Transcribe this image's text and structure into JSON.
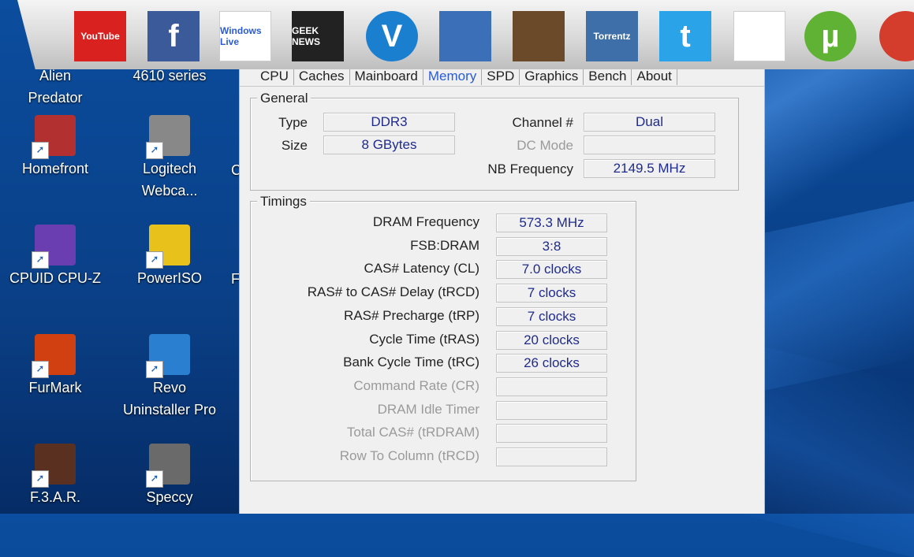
{
  "launcher": {
    "icons": [
      {
        "name": "youtube",
        "text": "YouTube",
        "color": "#d9211f"
      },
      {
        "name": "facebook",
        "text": "f",
        "color": "#3b5a9a"
      },
      {
        "name": "windows-live",
        "text": "Windows Live",
        "color": "#ffffff"
      },
      {
        "name": "news",
        "text": "GEEK NEWS",
        "color": "#222222"
      },
      {
        "name": "v-app",
        "text": "V",
        "color": "#1b7fd0"
      },
      {
        "name": "reddit-like",
        "text": "",
        "color": "#3b6fb8"
      },
      {
        "name": "chess",
        "text": "",
        "color": "#6b4a2a"
      },
      {
        "name": "torrentz",
        "text": "Torrentz",
        "color": "#3f6fa8"
      },
      {
        "name": "twitter",
        "text": "t",
        "color": "#2aa3e8"
      },
      {
        "name": "scrooge",
        "text": "",
        "color": "#ffffff"
      },
      {
        "name": "utorrent",
        "text": "µ",
        "color": "#5fb233"
      },
      {
        "name": "ccleaner",
        "text": "",
        "color": "#d43c2c"
      }
    ]
  },
  "desktop": {
    "icons": [
      {
        "label": "Alien\nPredator",
        "color": "#7a1a1a"
      },
      {
        "label": "4610 series",
        "color": "#c0c0c0"
      },
      {
        "label": "Homefront",
        "color": "#b23030"
      },
      {
        "label": "Logitech\nWebca...",
        "color": "#888888"
      },
      {
        "label": "CPUID CPU-Z",
        "color": "#6a3db0"
      },
      {
        "label": "PowerISO",
        "color": "#e8c21a"
      },
      {
        "label": "FurMark",
        "color": "#d04010"
      },
      {
        "label": "Revo\nUninstaller Pro",
        "color": "#2a7fd0"
      },
      {
        "label": "F.3.A.R.",
        "color": "#5a3020"
      },
      {
        "label": "Speccy",
        "color": "#6a6a6a"
      }
    ],
    "partials": [
      "C",
      "F"
    ]
  },
  "cpuz": {
    "tabs": [
      "CPU",
      "Caches",
      "Mainboard",
      "Memory",
      "SPD",
      "Graphics",
      "Bench",
      "About"
    ],
    "active_tab": "Memory",
    "general": {
      "legend": "General",
      "type_label": "Type",
      "type_value": "DDR3",
      "size_label": "Size",
      "size_value": "8 GBytes",
      "channel_label": "Channel #",
      "channel_value": "Dual",
      "dcmode_label": "DC Mode",
      "dcmode_value": "",
      "nbfreq_label": "NB Frequency",
      "nbfreq_value": "2149.5 MHz"
    },
    "timings": {
      "legend": "Timings",
      "rows": [
        {
          "label": "DRAM Frequency",
          "value": "573.3 MHz",
          "dim": false
        },
        {
          "label": "FSB:DRAM",
          "value": "3:8",
          "dim": false
        },
        {
          "label": "CAS# Latency (CL)",
          "value": "7.0 clocks",
          "dim": false
        },
        {
          "label": "RAS# to CAS# Delay (tRCD)",
          "value": "7 clocks",
          "dim": false
        },
        {
          "label": "RAS# Precharge (tRP)",
          "value": "7 clocks",
          "dim": false
        },
        {
          "label": "Cycle Time (tRAS)",
          "value": "20 clocks",
          "dim": false
        },
        {
          "label": "Bank Cycle Time (tRC)",
          "value": "26 clocks",
          "dim": false
        },
        {
          "label": "Command Rate (CR)",
          "value": "",
          "dim": true
        },
        {
          "label": "DRAM Idle Timer",
          "value": "",
          "dim": true
        },
        {
          "label": "Total CAS# (tRDRAM)",
          "value": "",
          "dim": true
        },
        {
          "label": "Row To Column (tRCD)",
          "value": "",
          "dim": true
        }
      ]
    }
  }
}
